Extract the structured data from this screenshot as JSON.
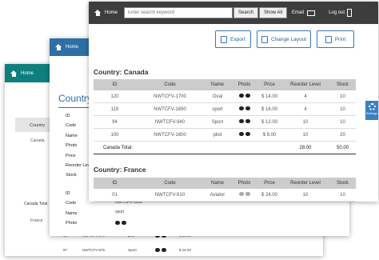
{
  "windows": {
    "back": {
      "home_label": "Home",
      "labels": [
        "Country",
        "Canada",
        "Canada Total",
        "France"
      ],
      "rows": [
        {
          "id": "92",
          "code": "NWTCFV-970",
          "name": "pilot",
          "price": "$ 10.00"
        },
        {
          "id": "97",
          "code": "NWTCFV-975",
          "name": "Sport",
          "price": "$ 16.00"
        }
      ]
    },
    "middle": {
      "home_label": "Home",
      "country_title": "Country:",
      "field_labels": [
        "ID",
        "Code",
        "Name",
        "Photo",
        "Price",
        "Reorder Level",
        "Stock"
      ],
      "field_labels_2": [
        "ID",
        "Code",
        "Name",
        "Photo"
      ],
      "second_values": {
        "code": "NWTCFV-1690",
        "name": "sport"
      }
    },
    "front": {
      "home_label": "Home",
      "search_placeholder": "Enter search keyword",
      "search_button": "Search",
      "show_all": "Show All",
      "email_label": "Email",
      "logout_label": "Log out",
      "buttons": {
        "export": "Export",
        "change_layout": "Change Layout",
        "print": "Print"
      },
      "settings_label": "Settings",
      "columns": [
        "ID",
        "Code",
        "Name",
        "Photo",
        "Price",
        "Reorder Level",
        "Stock"
      ],
      "groups": [
        {
          "title": "Country: Canada",
          "rows": [
            {
              "id": "120",
              "code": "NWTCFV-1700",
              "name": "Oval",
              "price": "$ 14.00",
              "reorder": "4",
              "stock": "10",
              "glasses": "dark"
            },
            {
              "id": "119",
              "code": "NWTCFV-1690",
              "name": "sport",
              "price": "$ 16.00",
              "reorder": "4",
              "stock": "10",
              "glasses": "dark"
            },
            {
              "id": "94",
              "code": "NWTCFV-940",
              "name": "Sport",
              "price": "$ 12.00",
              "reorder": "10",
              "stock": "10",
              "glasses": "dark"
            },
            {
              "id": "100",
              "code": "NWTCFV-1600",
              "name": "pilot",
              "price": "$ 9.00",
              "reorder": "10",
              "stock": "20",
              "glasses": "dark"
            }
          ],
          "total_label": "Canada Total:",
          "total_reorder": "28.00",
          "total_stock": "50.00"
        },
        {
          "title": "Country: France",
          "rows": [
            {
              "id": "01",
              "code": "NWTCFV-910",
              "name": "Aviator",
              "price": "$ 24.00",
              "reorder": "10",
              "stock": "10",
              "glasses": "silver"
            }
          ]
        }
      ]
    }
  }
}
